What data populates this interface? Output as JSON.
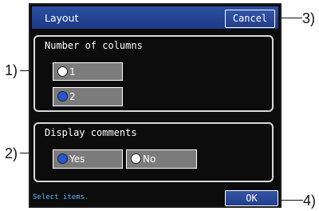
{
  "callouts": {
    "c1": "1)",
    "c2": "2)",
    "c3": "3)",
    "c4": "4)"
  },
  "dialog": {
    "title": "Layout",
    "cancel_label": "Cancel",
    "ok_label": "OK",
    "status_text": "Select items."
  },
  "columns_group": {
    "legend": "Number of columns",
    "options": [
      {
        "label": "1",
        "selected": false
      },
      {
        "label": "2",
        "selected": true
      }
    ]
  },
  "comments_group": {
    "legend": "Display comments",
    "options": [
      {
        "label": "Yes",
        "selected": true
      },
      {
        "label": "No",
        "selected": false
      }
    ]
  },
  "colors": {
    "title_bar": "#2a4fa2",
    "radio_selected": "#2756d3",
    "status_text": "#59b8ff"
  }
}
